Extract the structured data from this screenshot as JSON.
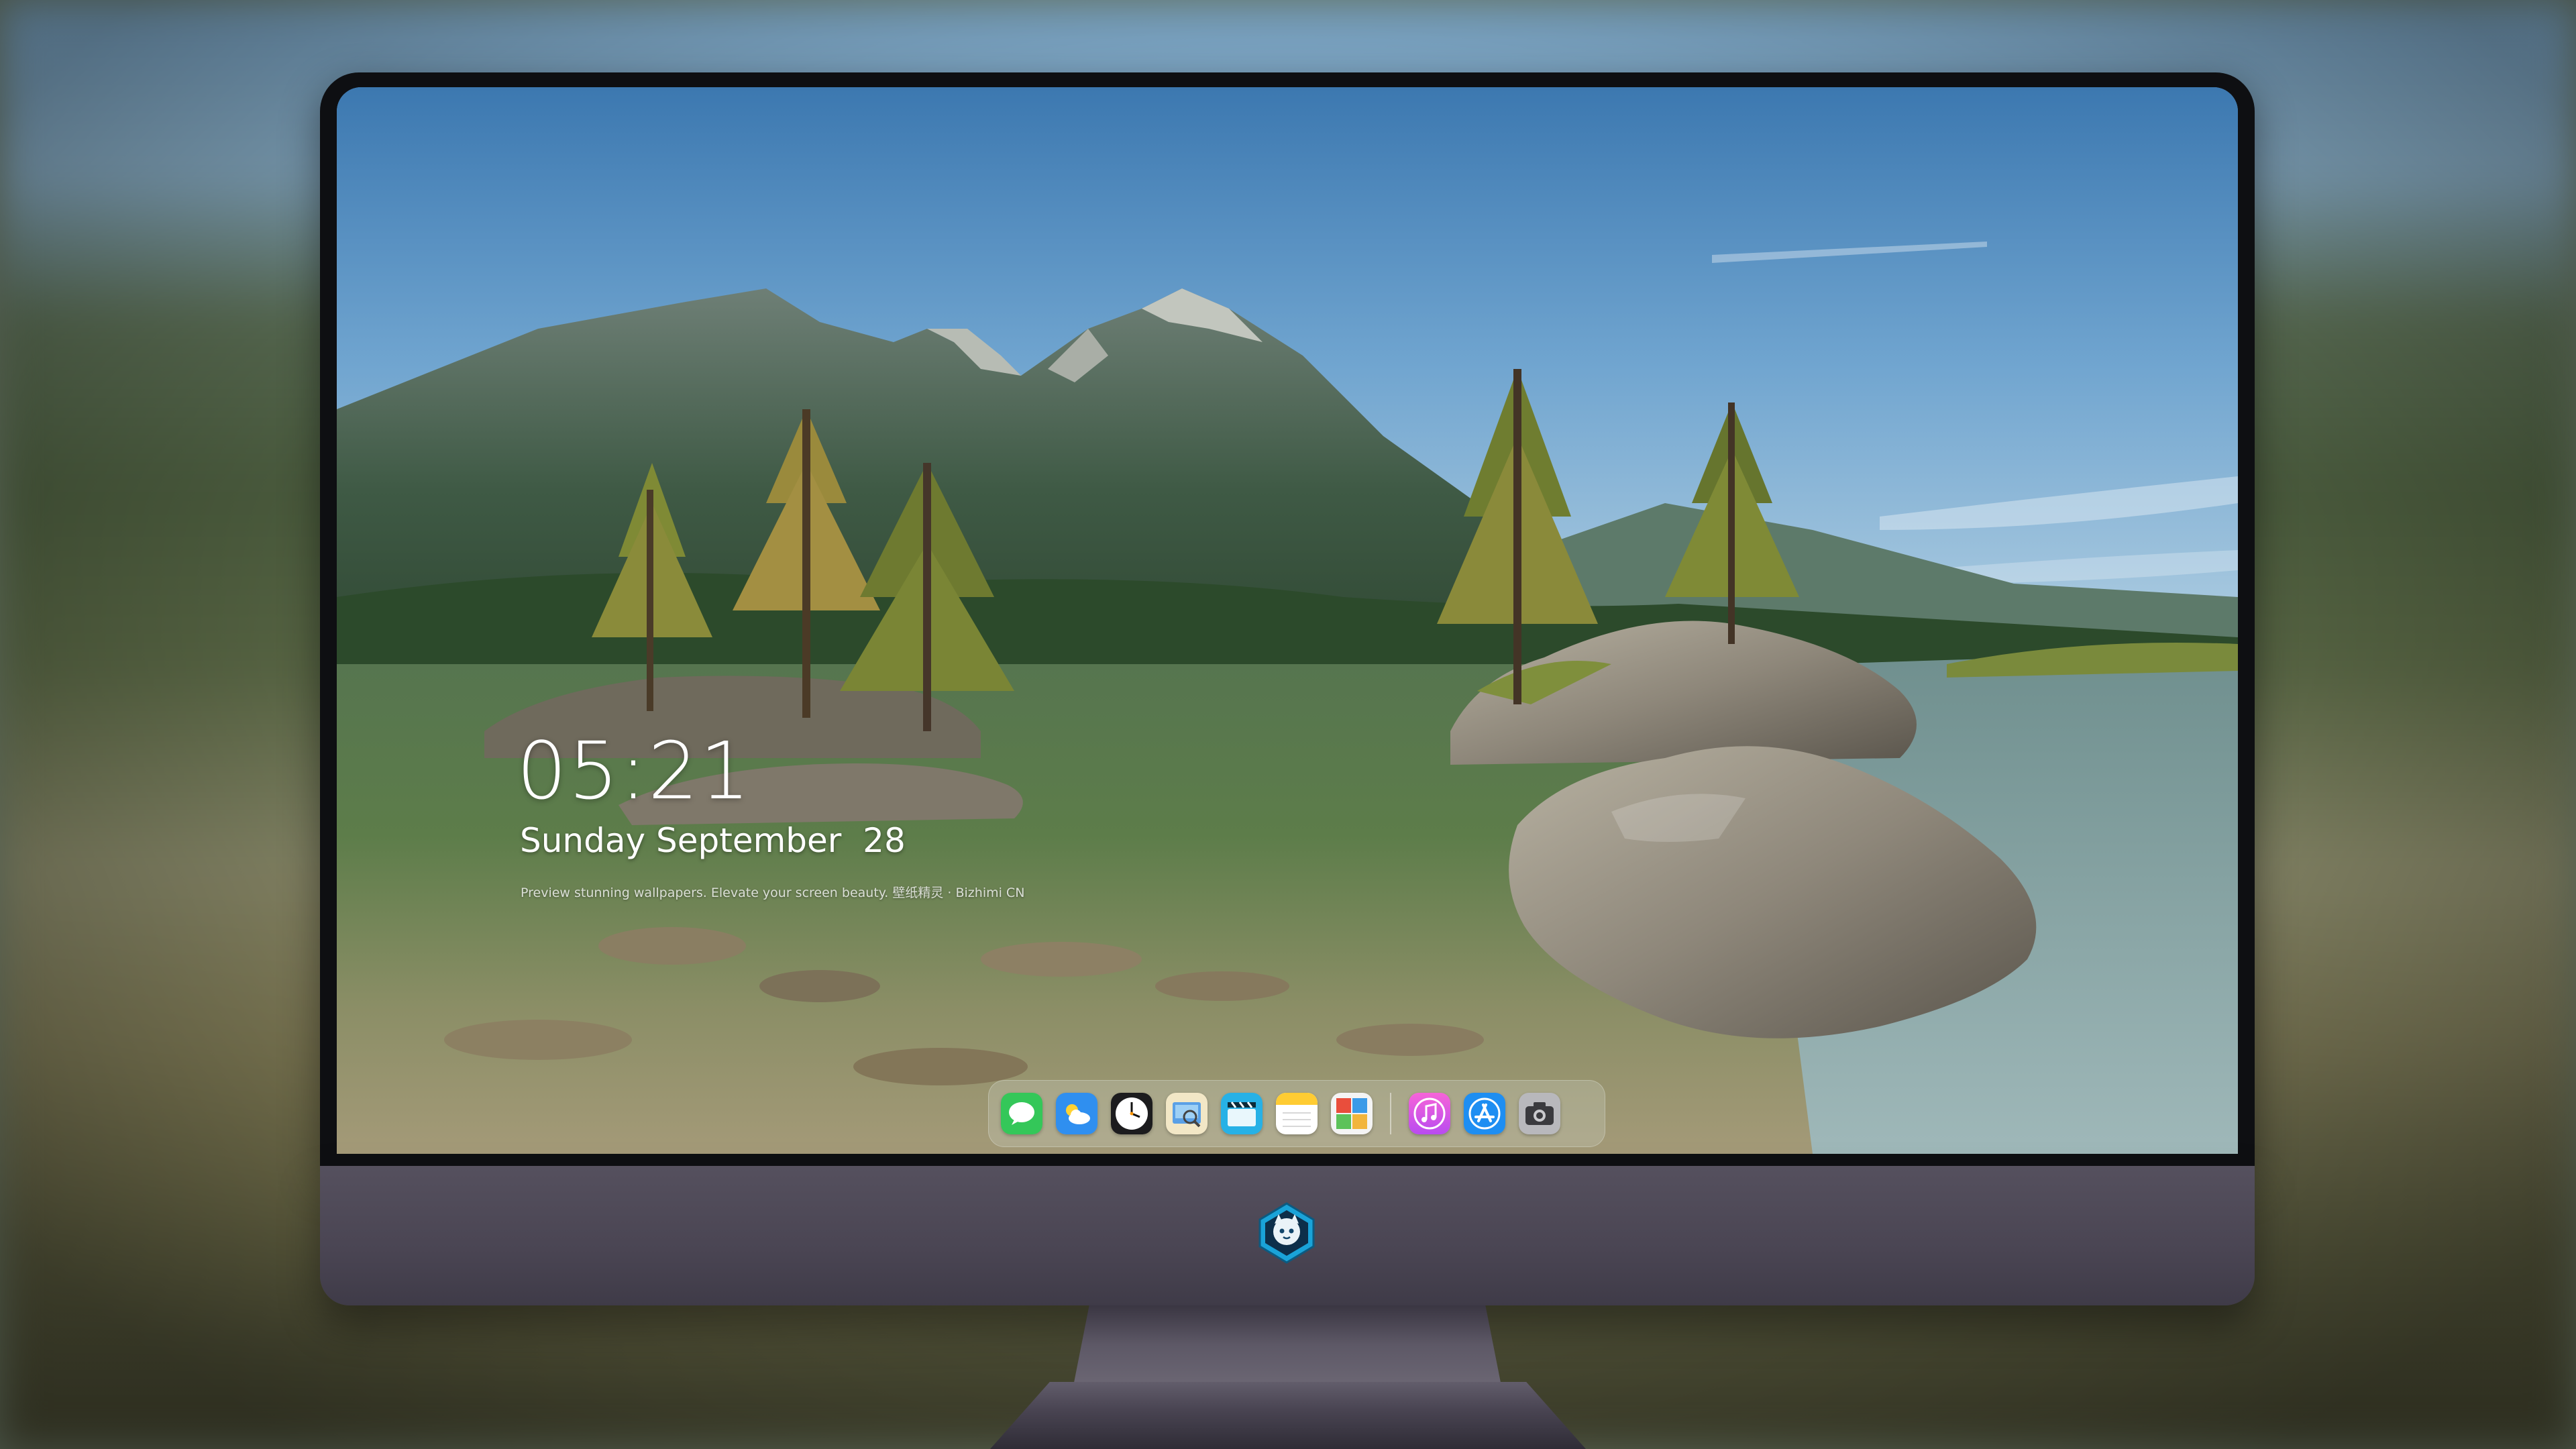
{
  "lockscreen": {
    "time": "05:21",
    "date": "Sunday September  28",
    "caption": "Preview stunning wallpapers. Elevate your screen beauty. 壁纸精灵 · Bizhimi CN"
  },
  "dock": {
    "apps": [
      {
        "name": "Messages",
        "icon": "messages-icon"
      },
      {
        "name": "Weather",
        "icon": "weather-icon"
      },
      {
        "name": "Clock",
        "icon": "clock-icon"
      },
      {
        "name": "Preview",
        "icon": "preview-icon"
      },
      {
        "name": "Clips",
        "icon": "clips-icon"
      },
      {
        "name": "Notes",
        "icon": "notes-icon"
      },
      {
        "name": "Photo Booth",
        "icon": "photo-booth-icon"
      },
      {
        "name": "Music",
        "icon": "music-icon"
      },
      {
        "name": "App Store",
        "icon": "app-store-icon"
      },
      {
        "name": "Camera",
        "icon": "camera-icon"
      }
    ]
  },
  "monitor": {
    "logo": "mascot-logo"
  }
}
